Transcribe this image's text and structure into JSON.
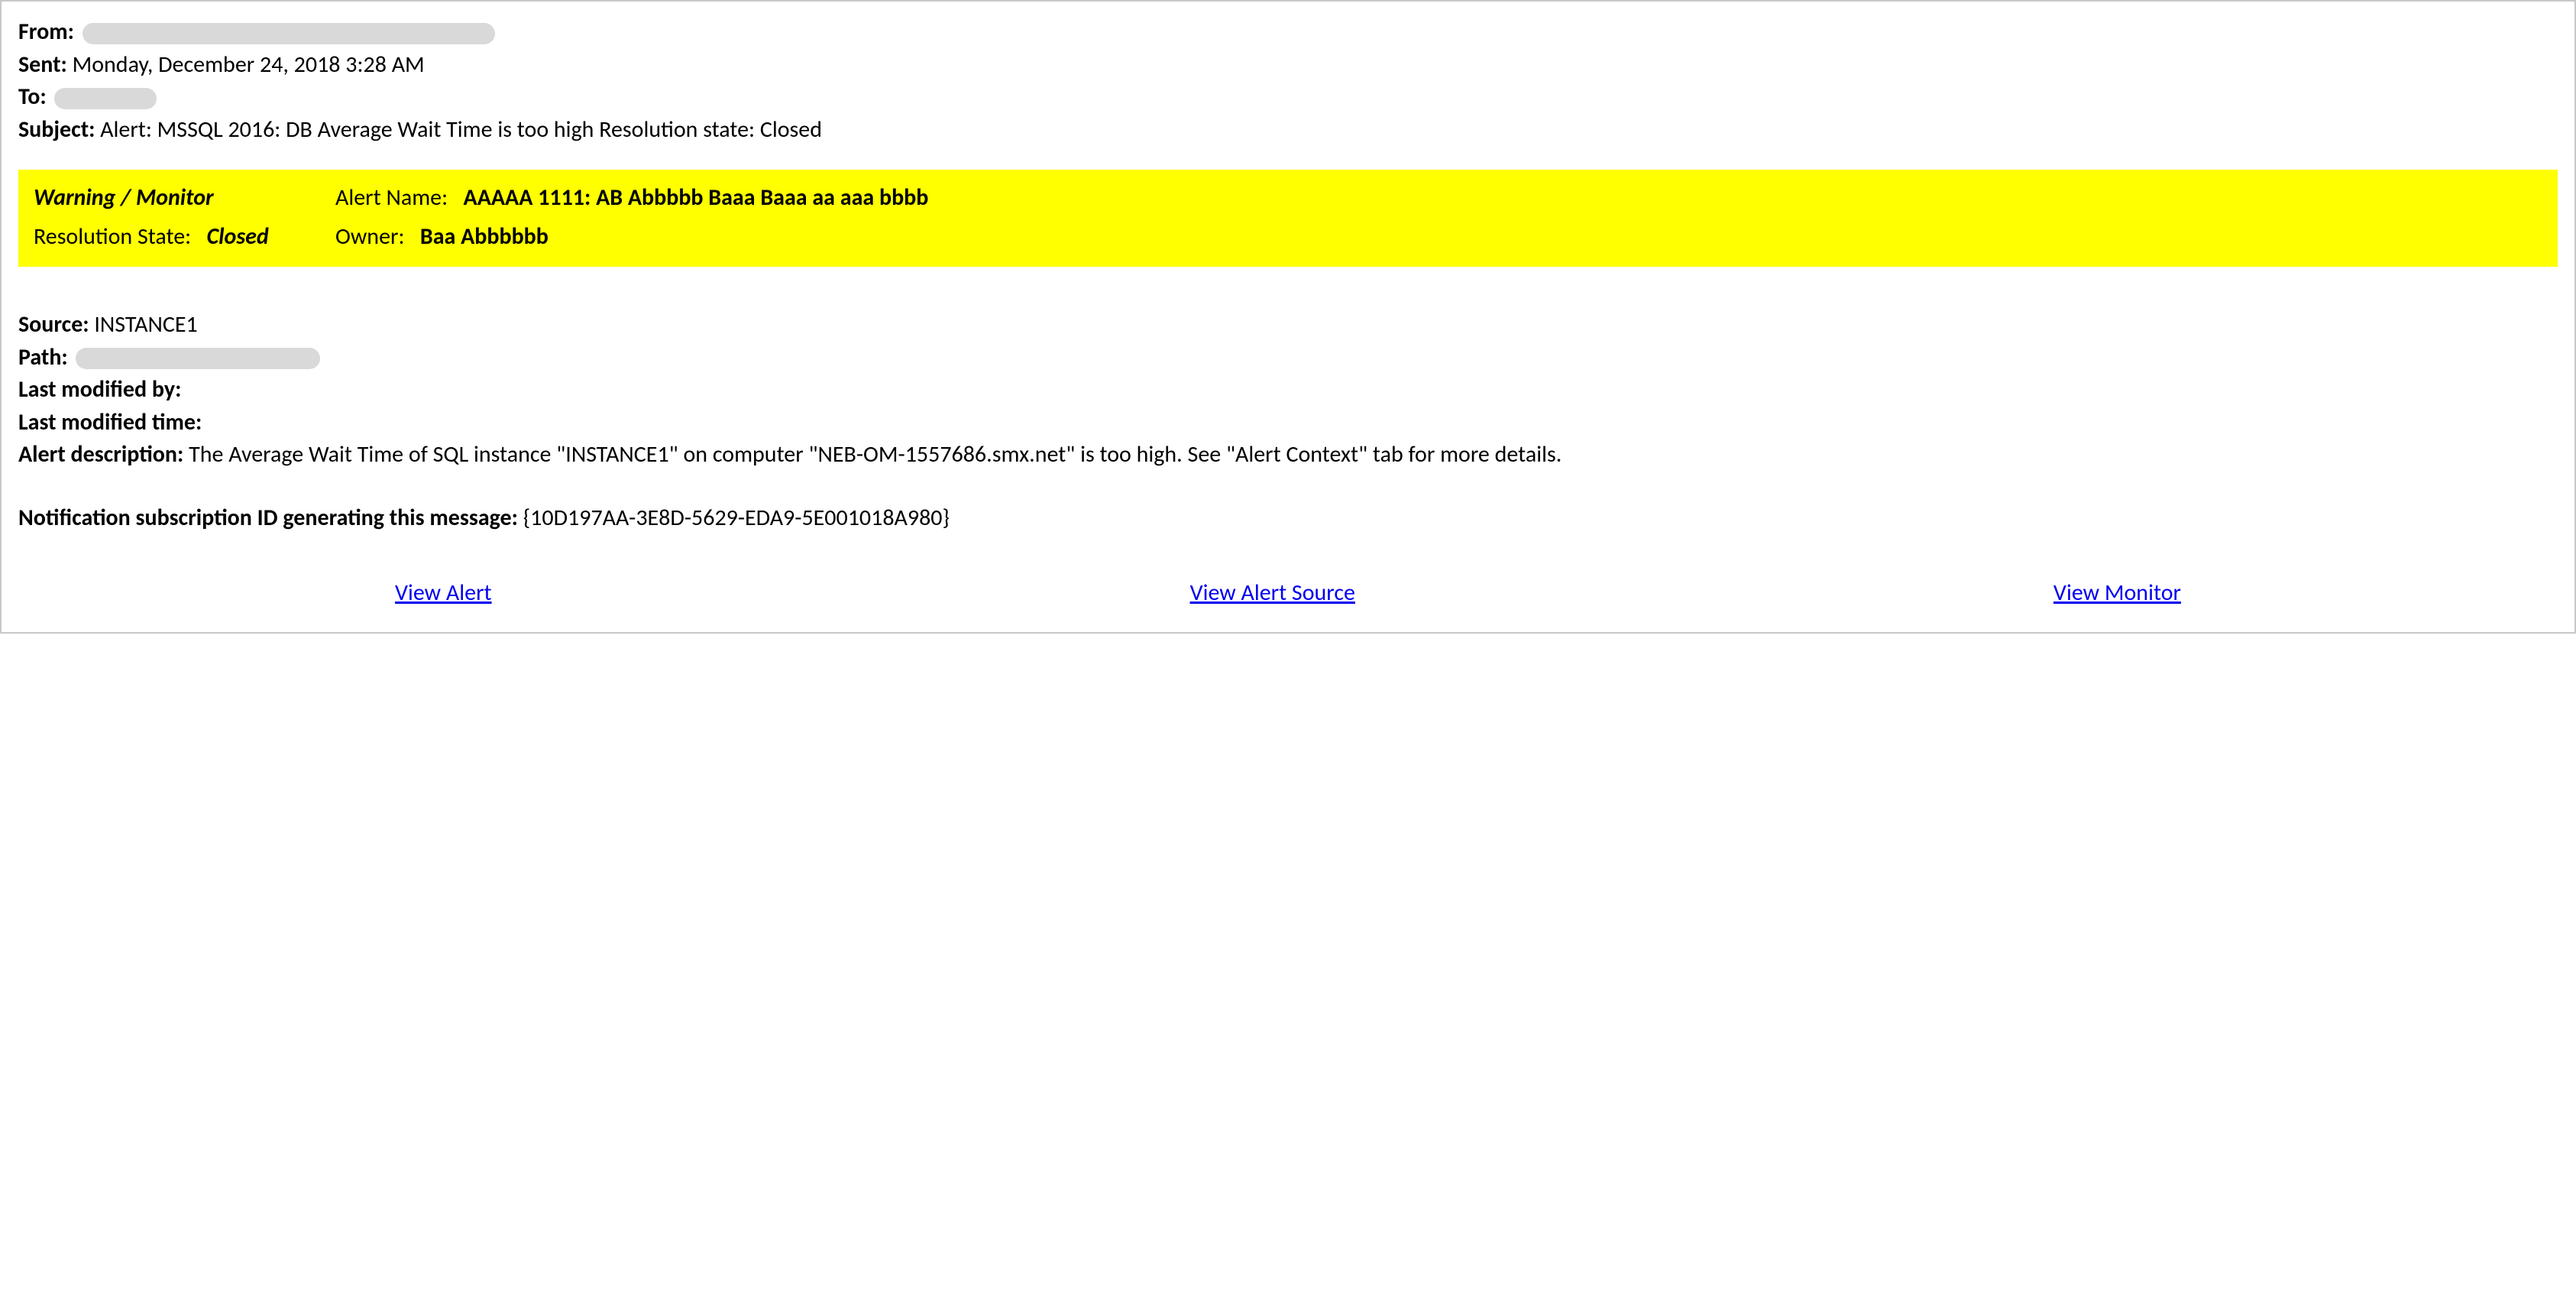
{
  "header": {
    "from_label": "From:",
    "from_value": "",
    "sent_label": "Sent:",
    "sent_value": "Monday, December 24, 2018 3:28 AM",
    "to_label": "To:",
    "to_value": "",
    "subject_label": "Subject:",
    "subject_value": "Alert: MSSQL 2016: DB Average Wait Time is too high Resolution state: Closed"
  },
  "highlight": {
    "severity": "Warning / Monitor",
    "alert_name_label": "Alert Name:",
    "alert_name_value": "AAAAA 1111: AB Abbbbb Baaa Baaa aa aaa bbbb",
    "resolution_label": "Resolution State:",
    "resolution_value": "Closed",
    "owner_label": "Owner:",
    "owner_value": "Baa Abbbbbb"
  },
  "details": {
    "source_label": "Source:",
    "source_value": "INSTANCE1",
    "path_label": "Path:",
    "path_value": "",
    "last_modified_by_label": "Last modified by:",
    "last_modified_by_value": "",
    "last_modified_time_label": "Last modified time:",
    "last_modified_time_value": "",
    "alert_description_label": "Alert description:",
    "alert_description_value": "The Average Wait Time of SQL instance \"INSTANCE1\" on computer \"NEB-OM-1557686.smx.net\" is too high. See \"Alert Context\" tab for more details.",
    "subscription_label": "Notification subscription ID generating this message:",
    "subscription_value": "{10D197AA-3E8D-5629-EDA9-5E001018A980}"
  },
  "links": {
    "view_alert": "View Alert",
    "view_alert_source": "View Alert Source",
    "view_monitor": "View Monitor"
  }
}
